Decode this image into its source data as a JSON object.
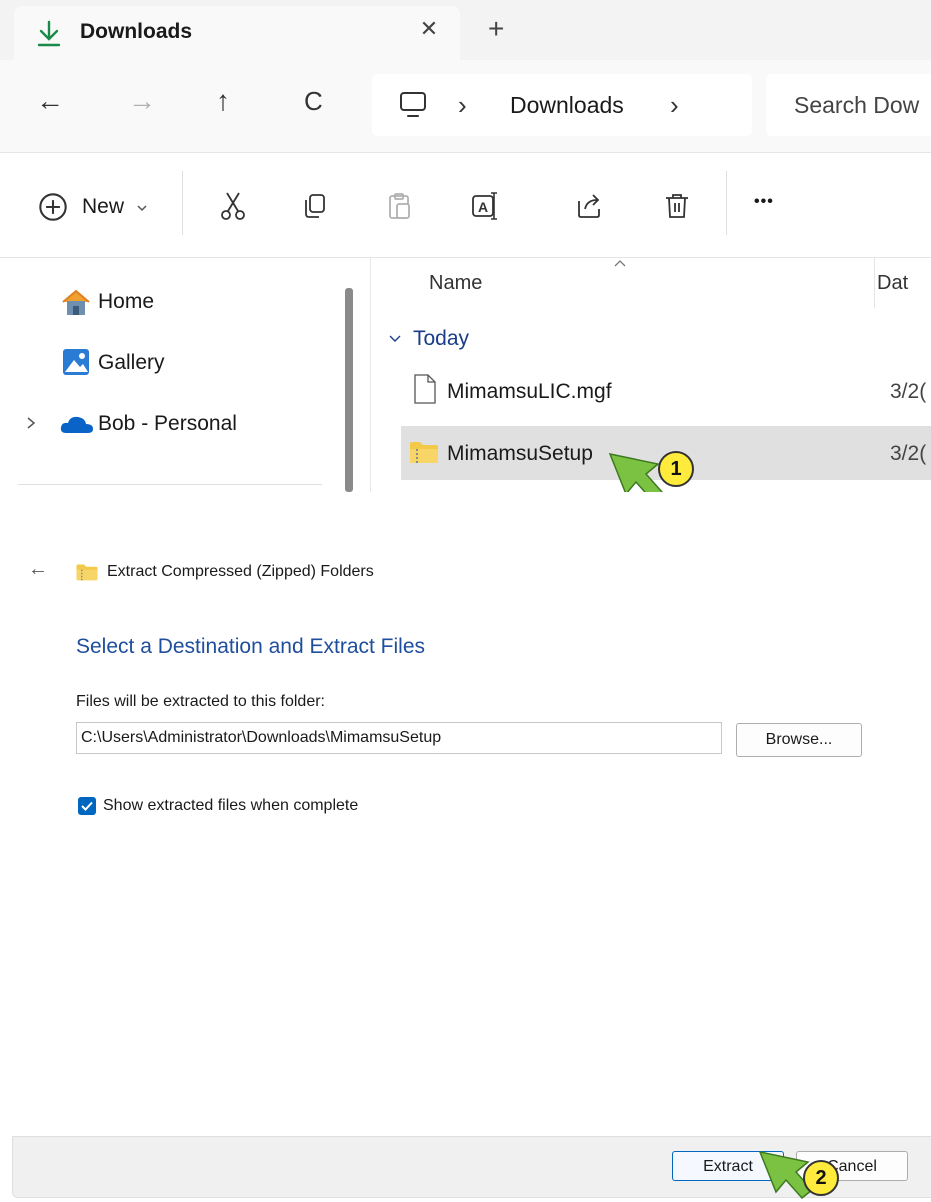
{
  "explorer": {
    "tab": {
      "title": "Downloads",
      "close_glyph": "✕",
      "new_tab_glyph": "+"
    },
    "nav": {
      "back_glyph": "←",
      "forward_glyph": "→",
      "up_glyph": "↑",
      "refresh_glyph": "C",
      "breadcrumb": "Downloads",
      "chevron": "›",
      "search_placeholder": "Search Dow"
    },
    "toolbar": {
      "new_label": "New",
      "more_glyph": "•••"
    },
    "sidebar": {
      "items": [
        {
          "label": "Home"
        },
        {
          "label": "Gallery"
        },
        {
          "label": "Bob - Personal"
        }
      ]
    },
    "file_list": {
      "columns": {
        "name": "Name",
        "date": "Dat"
      },
      "group": "Today",
      "files": [
        {
          "name": "MimamsuLIC.mgf",
          "date": "3/2("
        },
        {
          "name": "MimamsuSetup",
          "date": "3/2("
        }
      ]
    }
  },
  "dialog": {
    "title": "Extract Compressed (Zipped) Folders",
    "heading": "Select a Destination and Extract Files",
    "path_label": "Files will be extracted to this folder:",
    "path_value": "C:\\Users\\Administrator\\Downloads\\MimamsuSetup",
    "browse_label": "Browse...",
    "checkbox_label": "Show extracted files when complete",
    "checkbox_checked": true,
    "extract_label": "Extract",
    "cancel_label": "Cancel"
  },
  "annotations": [
    {
      "number": "1"
    },
    {
      "number": "2"
    }
  ],
  "colors": {
    "accent": "#0067c0",
    "heading_blue": "#1f4e9c",
    "group_blue": "#1a3c8a",
    "marker_fill": "#ffeb3b",
    "arrow_green": "#7cc242"
  }
}
